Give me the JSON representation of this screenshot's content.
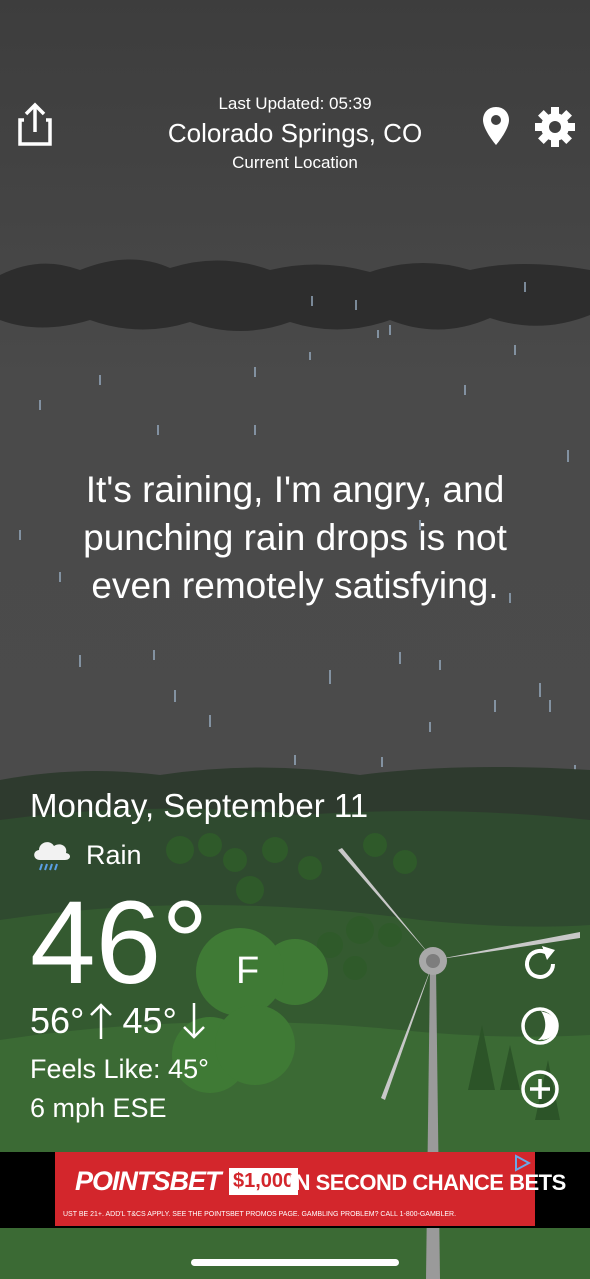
{
  "header": {
    "last_updated": "Last Updated: 05:39",
    "location": "Colorado Springs, CO",
    "location_label": "Current Location"
  },
  "message": "It's raining, I'm angry, and punching rain drops is not even remotely satisfying.",
  "weather": {
    "date": "Monday, September 11",
    "condition": "Rain",
    "condition_icon": "rain-cloud-icon",
    "temperature": "46°",
    "unit": "F",
    "high": "56°",
    "low": "45°",
    "feels_like": "Feels Like: 45°",
    "wind": "6 mph ESE"
  },
  "icons": {
    "share": "share-icon",
    "location_pin": "location-pin-icon",
    "settings": "gear-icon",
    "refresh": "refresh-icon",
    "theme": "moon-phase-icon",
    "add": "add-icon"
  },
  "ad": {
    "brand_a": "POINTS",
    "brand_b": "BET",
    "amount": "$1,000",
    "headline": "IN SECOND CHANCE BETS",
    "fine_print": "UST BE 21+. ADD'L T&CS APPLY. SEE THE POINTSBET PROMOS PAGE. GAMBLING PROBLEM? CALL 1-800-GAMBLER.",
    "color": "#d3262c"
  }
}
